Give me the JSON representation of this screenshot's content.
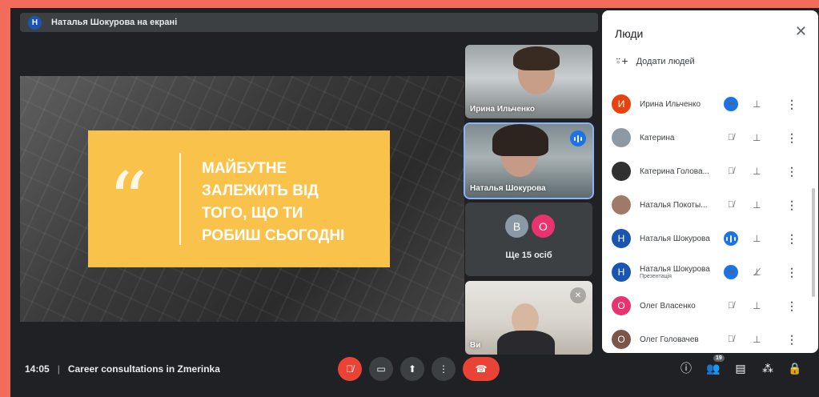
{
  "presenter_bar": {
    "avatar_letter": "Н",
    "text": "Наталья Шокурова на екрані"
  },
  "slide": {
    "quote_mark": "“",
    "lines": [
      "МАЙБУТНЕ",
      "ЗАЛЕЖИТЬ ВІД",
      "ТОГО, ЩО ТИ",
      "РОБИШ СЬОГОДНІ"
    ]
  },
  "tiles": {
    "t1_name": "Ирина Ильченко",
    "t2_name": "Наталья Шокурова",
    "t3_avatars": [
      "В",
      "О"
    ],
    "t3_text": "Ще 15 осіб",
    "t4_name": "Ви"
  },
  "panel": {
    "title": "Люди",
    "add_label": "Додати людей",
    "people": [
      {
        "letter": "И",
        "color": "#e8430f",
        "name": "Ирина Ильченко",
        "sub": "",
        "status": "more"
      },
      {
        "letter": "",
        "color": "#8d9aa3",
        "name": "Катерина",
        "sub": "",
        "status": "muted"
      },
      {
        "letter": "",
        "color": "#303030",
        "name": "Катерина Голова...",
        "sub": "",
        "status": "muted"
      },
      {
        "letter": "",
        "color": "#a07a68",
        "name": "Наталья Покоты...",
        "sub": "",
        "status": "muted"
      },
      {
        "letter": "Н",
        "color": "#1a56b0",
        "name": "Наталья Шокурова",
        "sub": "",
        "status": "speaking"
      },
      {
        "letter": "Н",
        "color": "#1a56b0",
        "name": "Наталья Шокурова",
        "sub": "Презентація",
        "status": "more"
      },
      {
        "letter": "О",
        "color": "#e8336f",
        "name": "Олег Власенко",
        "sub": "",
        "status": "muted"
      },
      {
        "letter": "О",
        "color": "#7a5548",
        "name": "Олег Головачев",
        "sub": "",
        "status": "muted"
      }
    ]
  },
  "bottom": {
    "time": "14:05",
    "separator": "|",
    "meeting": "Career consultations in Zmerinka",
    "participants_count": "19"
  },
  "colors": {
    "accent": "#1a73e8",
    "danger": "#ea4335",
    "slide_card": "#f9c24a",
    "bg": "#202124"
  }
}
